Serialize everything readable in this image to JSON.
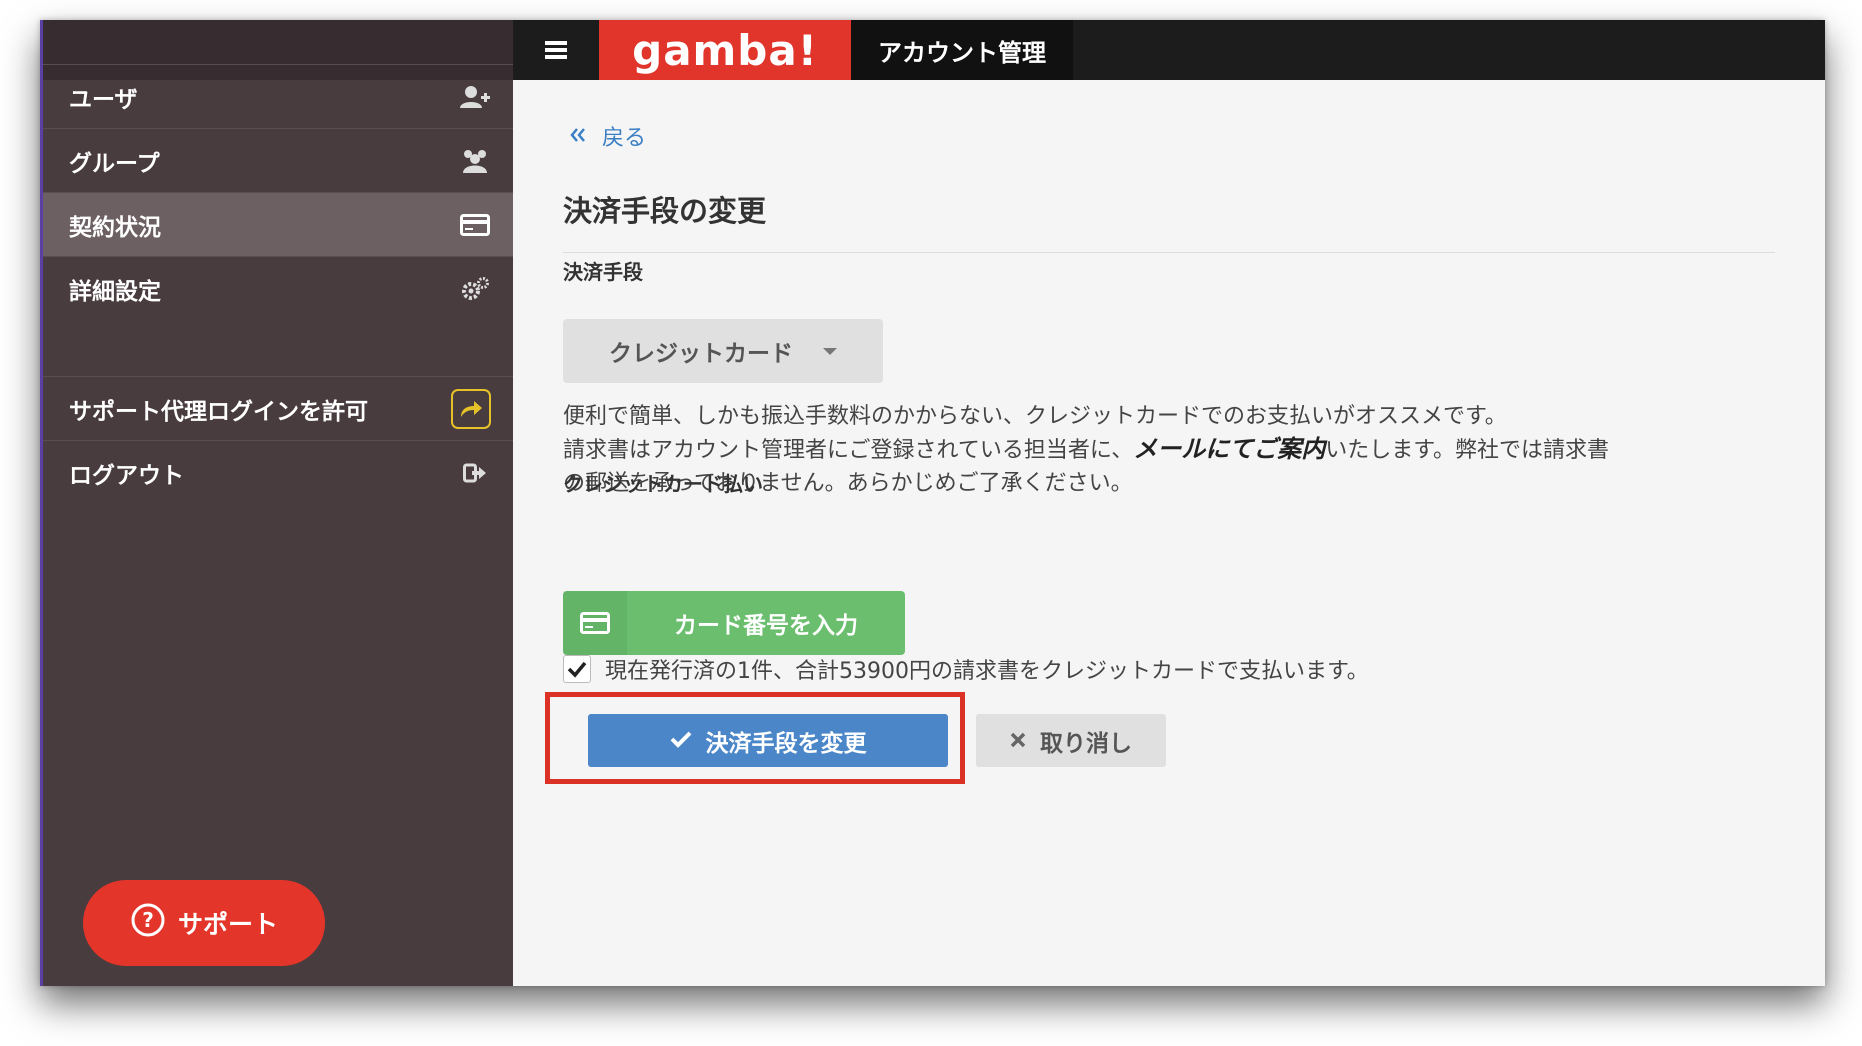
{
  "topbar": {
    "logo": "gamba!",
    "title": "アカウント管理"
  },
  "sidebar": {
    "items": [
      {
        "label": "ユーザ",
        "icon": "add-user-icon"
      },
      {
        "label": "グループ",
        "icon": "group-icon"
      },
      {
        "label": "契約状況",
        "icon": "credit-card-icon",
        "active": true
      },
      {
        "label": "詳細設定",
        "icon": "gears-icon"
      },
      {
        "label": "サポート代理ログインを許可",
        "icon": "share-arrow-icon"
      },
      {
        "label": "ログアウト",
        "icon": "logout-icon"
      }
    ],
    "support_label": "サポート"
  },
  "main": {
    "back_label": "戻る",
    "title": "決済手段の変更",
    "method_label": "決済手段",
    "method_value": "クレジットカード",
    "description_line1": "便利で簡単、しかも振込手数料のかからない、クレジットカードでのお支払いがオススメです。",
    "description_line2_pre": "請求書はアカウント管理者にご登録されている担当者に、",
    "description_line2_emph": "メールにてご案内",
    "description_line2_post": "いたします。弊社では請求書",
    "description_line3": "の郵送を承っておりません。あらかじめご了承ください。",
    "card_section_label": "クレジットカード払い",
    "card_button_label": "カード番号を入力",
    "agree_text": "現在発行済の1件、合計53900円の請求書をクレジットカードで支払います。",
    "agree_checked": true,
    "submit_label": "決済手段を変更",
    "cancel_label": "取り消し"
  },
  "colors": {
    "brand_red": "#e1352b",
    "sidebar_bg": "#483c3f",
    "primary_blue": "#4a86c8",
    "card_green": "#6abe6d",
    "highlight_red": "#dc3226"
  }
}
